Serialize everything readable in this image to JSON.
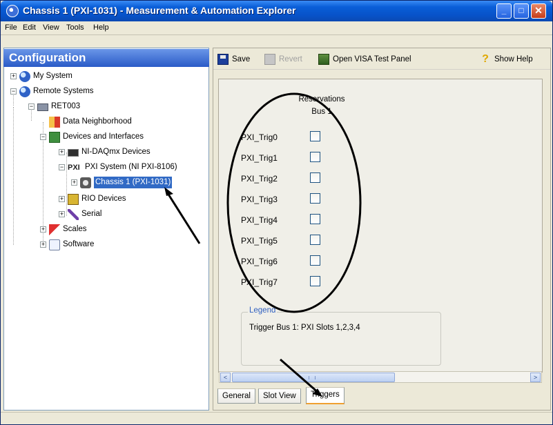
{
  "window": {
    "title": "Chassis 1 (PXI-1031) - Measurement & Automation Explorer",
    "minimize": "_",
    "maximize": "□",
    "close": "✕"
  },
  "menu": [
    "File",
    "Edit",
    "View",
    "Tools",
    "Help"
  ],
  "sidebar": {
    "header": "Configuration",
    "tree": {
      "my_system": "My System",
      "remote_systems": "Remote Systems",
      "ret003": "RET003",
      "data_neighborhood": "Data Neighborhood",
      "devices_and_interfaces": "Devices and Interfaces",
      "ni_daqmx_devices": "NI-DAQmx Devices",
      "pxi_system": "PXI System (NI PXI-8106)",
      "chassis": "Chassis 1 (PXI-1031)",
      "rio_devices": "RIO Devices",
      "serial": "Serial",
      "scales": "Scales",
      "software": "Software"
    },
    "pxi_icon_text": "PXI"
  },
  "toolbar": {
    "save": "Save",
    "revert": "Revert",
    "open_visa": "Open VISA Test Panel",
    "show_help": "Show Help"
  },
  "reservations": {
    "header_line1": "Reservations",
    "header_line2": "Bus 1",
    "triggers": [
      {
        "label": "PXI_Trig0",
        "checked": false
      },
      {
        "label": "PXI_Trig1",
        "checked": false
      },
      {
        "label": "PXI_Trig2",
        "checked": false
      },
      {
        "label": "PXI_Trig3",
        "checked": false
      },
      {
        "label": "PXI_Trig4",
        "checked": false
      },
      {
        "label": "PXI_Trig5",
        "checked": false
      },
      {
        "label": "PXI_Trig6",
        "checked": false
      },
      {
        "label": "PXI_Trig7",
        "checked": false
      }
    ]
  },
  "legend": {
    "title": "Legend",
    "text": "Trigger Bus 1: PXI Slots 1,2,3,4"
  },
  "scrollbar": {
    "left": "<",
    "right": ">"
  },
  "tabs": {
    "general": "General",
    "slot_view": "Slot View",
    "triggers": "Triggers"
  },
  "colors": {
    "selection": "#316ac5",
    "titlebar": "#0753c9",
    "annotation": "#000000"
  }
}
